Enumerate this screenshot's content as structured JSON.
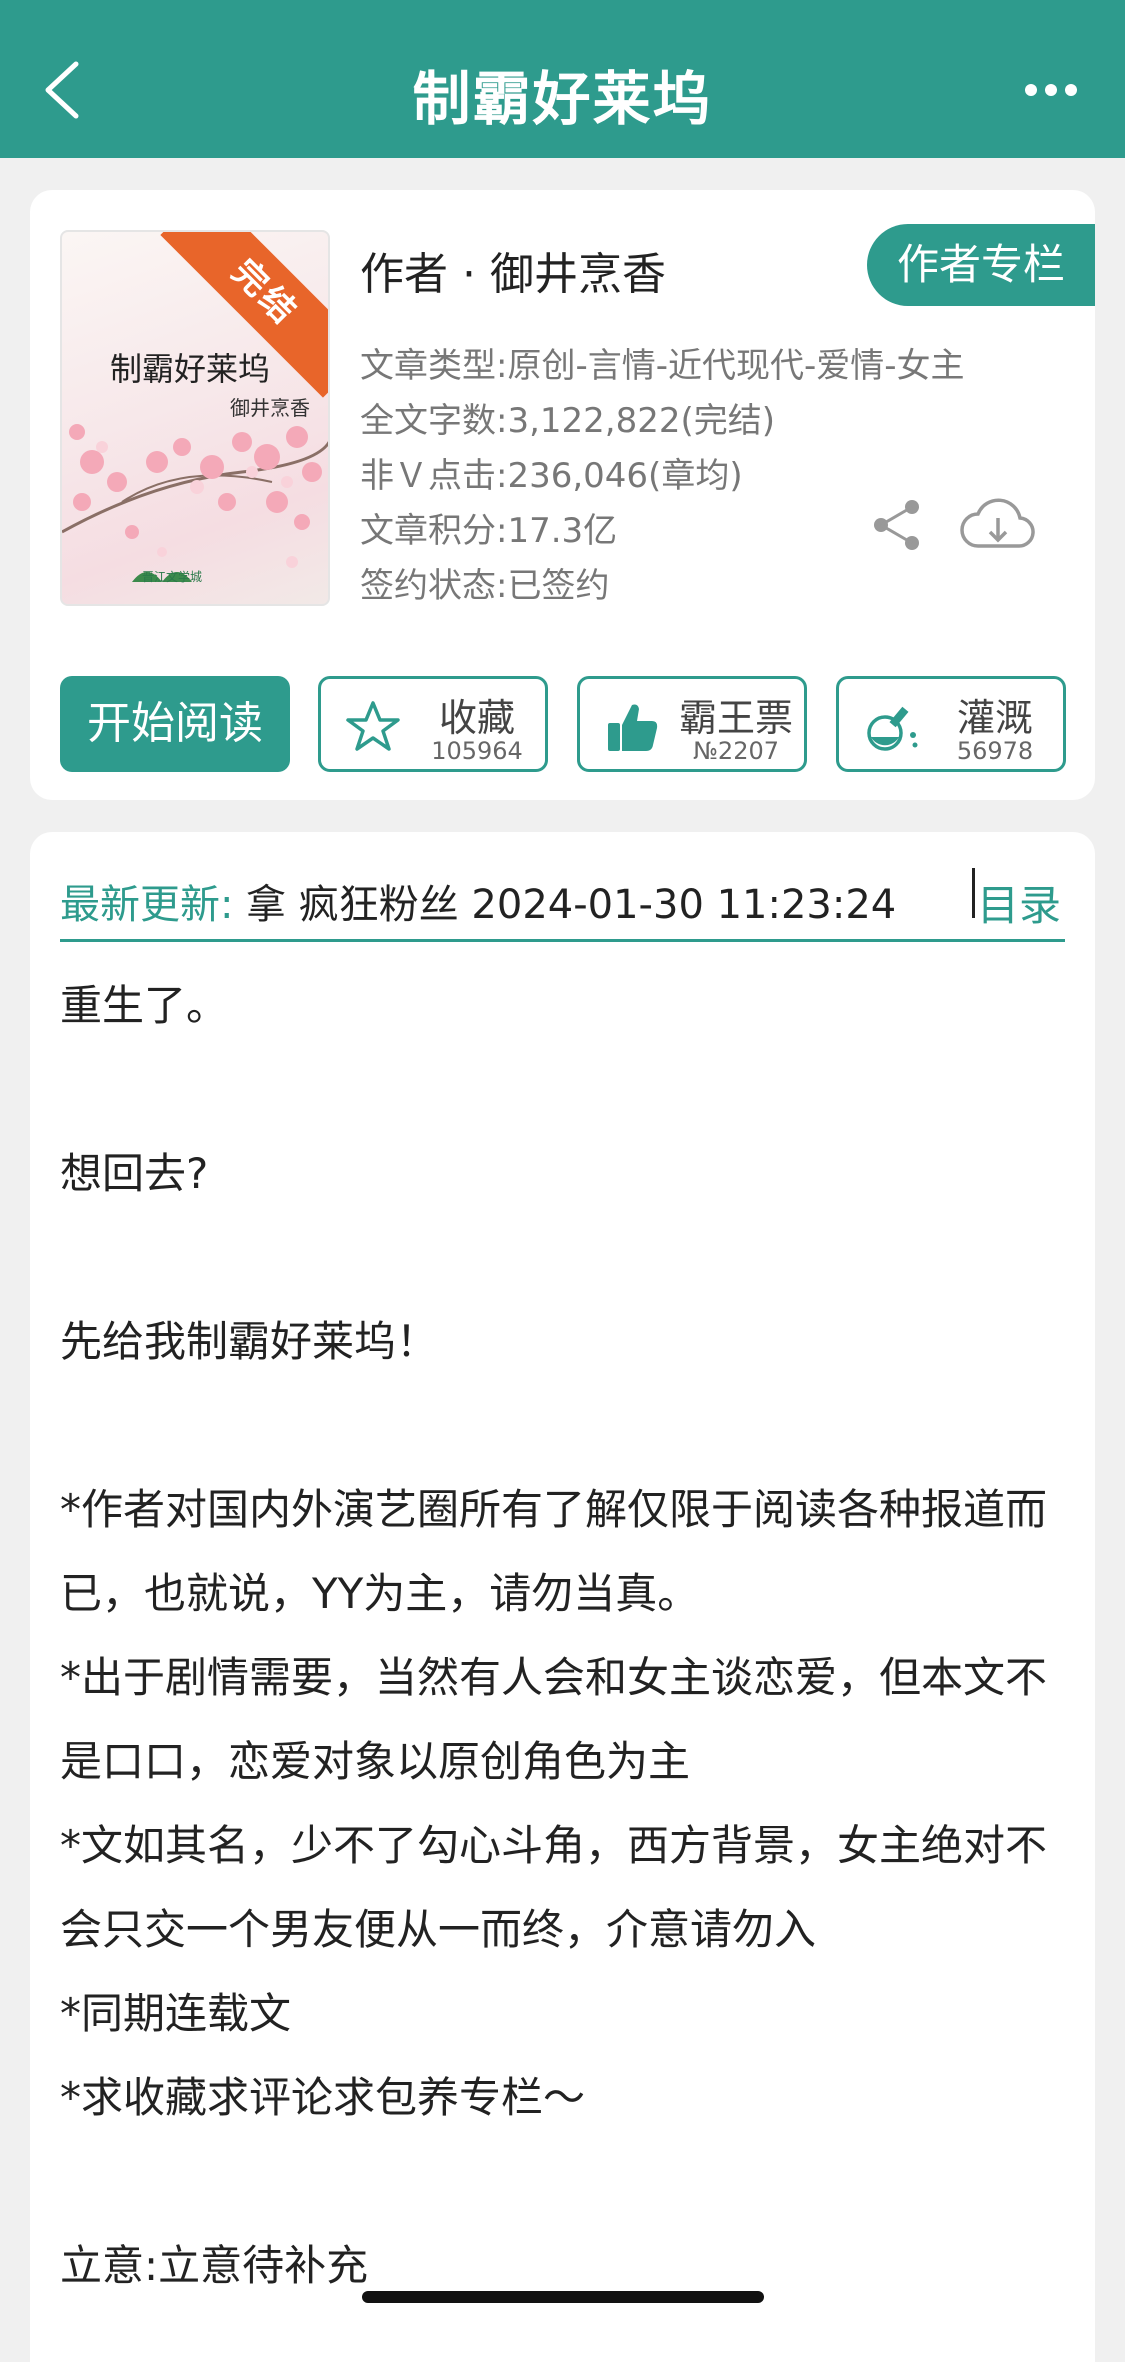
{
  "header": {
    "title": "制霸好莱坞"
  },
  "book": {
    "cover": {
      "ribbon": "完结",
      "title": "制霸好莱坞",
      "author": "御井烹香",
      "publisher_logo": "晋江文学城"
    },
    "author_line": "作者 · 御井烹香",
    "author_column_button": "作者专栏",
    "meta": [
      "文章类型:原创-言情-近代现代-爱情-女主",
      "全文字数:3,122,822(完结)",
      "非Ｖ点击:236,046(章均)",
      "文章积分:17.3亿",
      "签约状态:已签约"
    ]
  },
  "actions": {
    "read": "开始阅读",
    "favorite": {
      "label": "收藏",
      "count": "105964"
    },
    "vote": {
      "label": "霸王票",
      "count": "№2207"
    },
    "irrigate": {
      "label": "灌溉",
      "count": "56978"
    }
  },
  "update": {
    "label": "最新更新:",
    "text": "拿 疯狂粉丝 2024-01-30 11:23:24",
    "toc": "目录"
  },
  "content": [
    "重生了。",
    "",
    "想回去?",
    "",
    "先给我制霸好莱坞！",
    "",
    "*作者对国内外演艺圈所有了解仅限于阅读各种报道而已，也就说，YY为主，请勿当真。",
    "*出于剧情需要，当然有人会和女主谈恋爱，但本文不是口口，恋爱对象以原创角色为主",
    "*文如其名，少不了勾心斗角，西方背景，女主绝对不会只交一个男友便从一而终，介意请勿入",
    "*同期连载文",
    "*求收藏求评论求包养专栏～",
    "",
    "立意:立意待补充"
  ],
  "colors": {
    "accent": "#2e9b8d",
    "ribbon": "#e8652a"
  }
}
